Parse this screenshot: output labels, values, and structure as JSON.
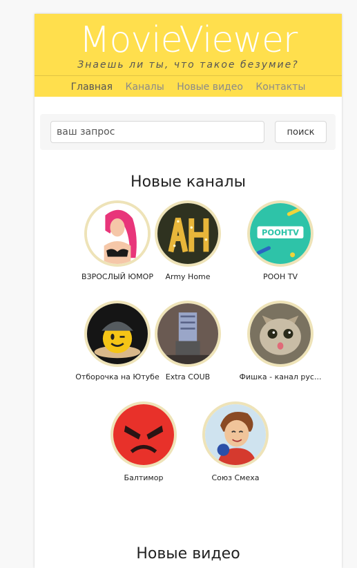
{
  "site": {
    "logo": "MovieViewer",
    "tagline": "Знаешь ли ты, что такое безумие?"
  },
  "nav": [
    {
      "label": "Главная",
      "active": true
    },
    {
      "label": "Каналы",
      "active": false
    },
    {
      "label": "Новые видео",
      "active": false
    },
    {
      "label": "Контакты",
      "active": false
    }
  ],
  "search": {
    "placeholder": "ваш запрос",
    "button_label": "поиск"
  },
  "sections": {
    "new_channels": "Новые каналы",
    "new_videos": "Новые видео"
  },
  "channels": [
    {
      "name": "ВЗРОСЛЫЙ ЮМОР",
      "avatar": "pink-hair-girl"
    },
    {
      "name": "Army Home",
      "avatar": "marquee-letters-ah"
    },
    {
      "name": "POOH TV",
      "avatar": "pooh-tv-logo"
    },
    {
      "name": "Отборочка на Ютубе",
      "avatar": "smiley-with-hat"
    },
    {
      "name": "Extra COUB",
      "avatar": "cartoon-character"
    },
    {
      "name": "Фишка - канал рус...",
      "avatar": "surprised-cat"
    },
    {
      "name": "Балтимор",
      "avatar": "angry-red-face"
    },
    {
      "name": "Союз Смеха",
      "avatar": "cartoon-boy"
    }
  ],
  "colors": {
    "header_bg": "#ffdf4d",
    "page_bg": "#ffffff",
    "avatar_border": "#eee3b8"
  }
}
